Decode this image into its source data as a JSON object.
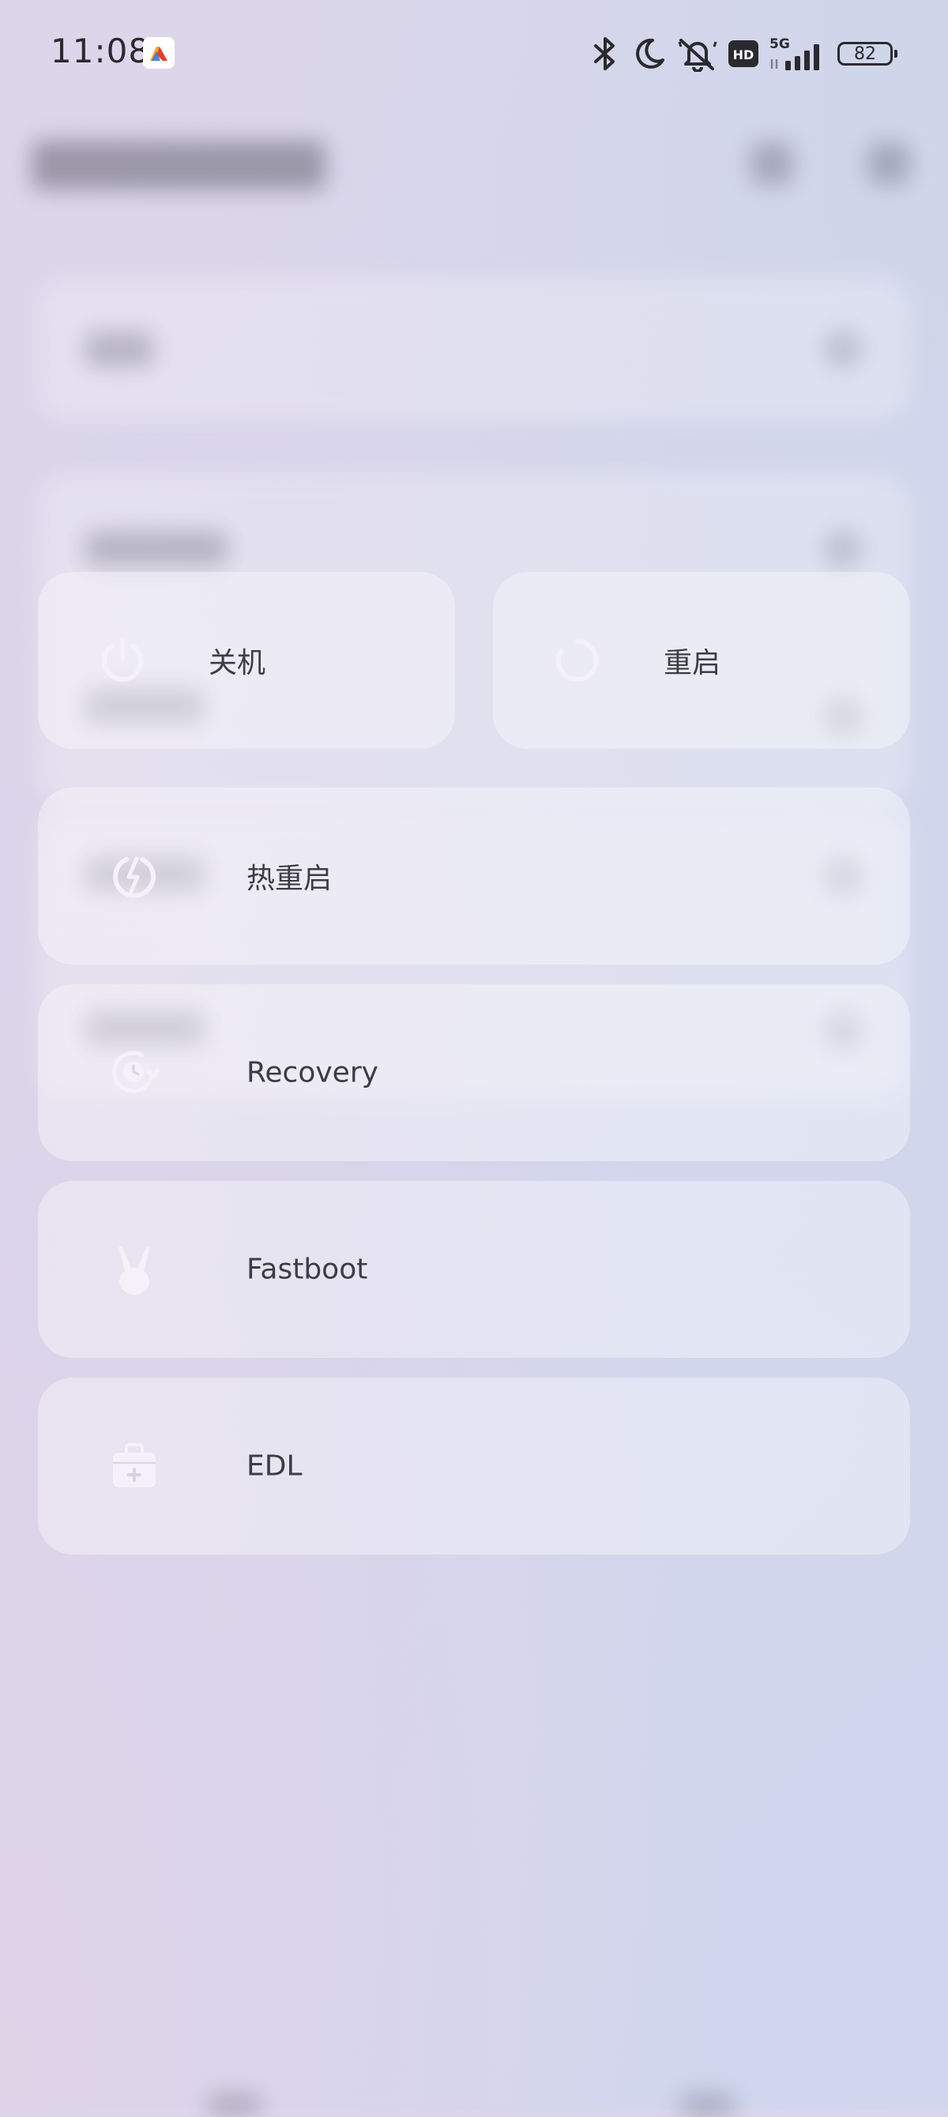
{
  "status_bar": {
    "time": "11:08",
    "notification_app_icon": "app-notification-icon",
    "icons": [
      "bluetooth-icon",
      "moon-icon",
      "mute-bell-icon",
      "hd-icon",
      "5g-signal-icon"
    ],
    "hd_label": "HD",
    "network_label": "5G",
    "battery_level": "82"
  },
  "power_menu": {
    "shutdown": {
      "label": "关机",
      "icon": "power-icon"
    },
    "reboot": {
      "label": "重启",
      "icon": "restart-icon"
    },
    "hot_reboot": {
      "label": "热重启",
      "icon": "lightning-icon"
    },
    "recovery": {
      "label": "Recovery",
      "icon": "recovery-icon"
    },
    "fastboot": {
      "label": "Fastboot",
      "icon": "rabbit-icon"
    },
    "edl": {
      "label": "EDL",
      "icon": "medical-kit-icon"
    }
  },
  "colors": {
    "icon_fill": "#f4f2f8",
    "label_text": "#3c3c44",
    "card_bg": "rgba(255,255,255,0.36)"
  }
}
